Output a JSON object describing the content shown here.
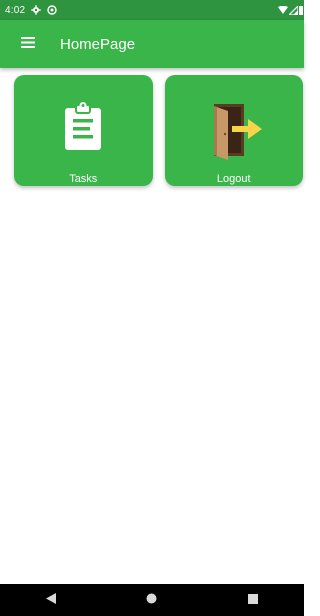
{
  "status_bar": {
    "time": "4:02",
    "icons": [
      "settings-icon",
      "do-not-disturb-icon",
      "wifi-icon",
      "signal-icon",
      "battery-icon"
    ]
  },
  "app_bar": {
    "title": "HomePage",
    "menu_icon": "hamburger-menu-icon"
  },
  "cards": [
    {
      "label": "Tasks",
      "icon": "clipboard-icon"
    },
    {
      "label": "Logout",
      "icon": "exit-door-icon"
    }
  ],
  "navigation": {
    "buttons": [
      "back-icon",
      "home-icon",
      "recents-icon"
    ]
  },
  "colors": {
    "app_bar": "#39b54a",
    "status_bar": "#2e9440",
    "card": "#39b54a",
    "nav_bar": "#000000"
  }
}
